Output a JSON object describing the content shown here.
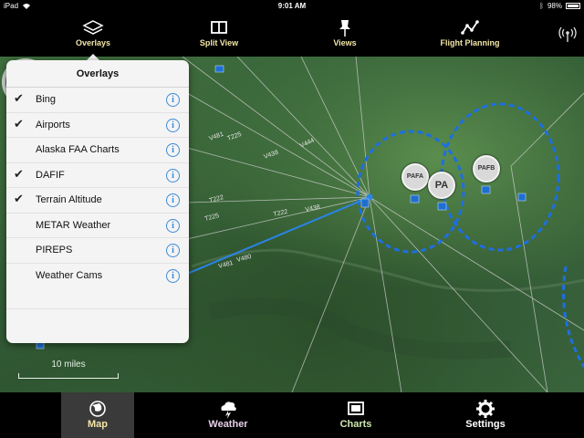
{
  "status_bar": {
    "device": "iPad",
    "time": "9:01 AM",
    "battery": "98%"
  },
  "toolbar": {
    "overlays_label": "Overlays",
    "split_view_label": "Split View",
    "views_label": "Views",
    "flight_planning_label": "Flight Planning"
  },
  "overlays_panel": {
    "title": "Overlays",
    "items": [
      {
        "label": "Bing",
        "checked": true
      },
      {
        "label": "Airports",
        "checked": true
      },
      {
        "label": "Alaska FAA Charts",
        "checked": false
      },
      {
        "label": "DAFIF",
        "checked": true
      },
      {
        "label": "Terrain Altitude",
        "checked": true
      },
      {
        "label": "METAR Weather",
        "checked": false
      },
      {
        "label": "PIREPS",
        "checked": false
      },
      {
        "label": "Weather Cams",
        "checked": false
      }
    ],
    "check_glyph": "✔",
    "info_glyph": "i"
  },
  "map": {
    "scale_label": "10 miles",
    "airports": [
      "PAFA",
      "PA",
      "PAFB"
    ],
    "airway_labels": [
      "V481",
      "T225",
      "V438",
      "V444",
      "T222",
      "V438",
      "V481",
      "V480",
      "T225",
      "T222"
    ],
    "colors": {
      "airspace": "#1d6fe0",
      "airway": "#c9c9c9",
      "compass_red": "#d62020"
    }
  },
  "tabbar": {
    "map_label": "Map",
    "weather_label": "Weather",
    "charts_label": "Charts",
    "settings_label": "Settings"
  }
}
